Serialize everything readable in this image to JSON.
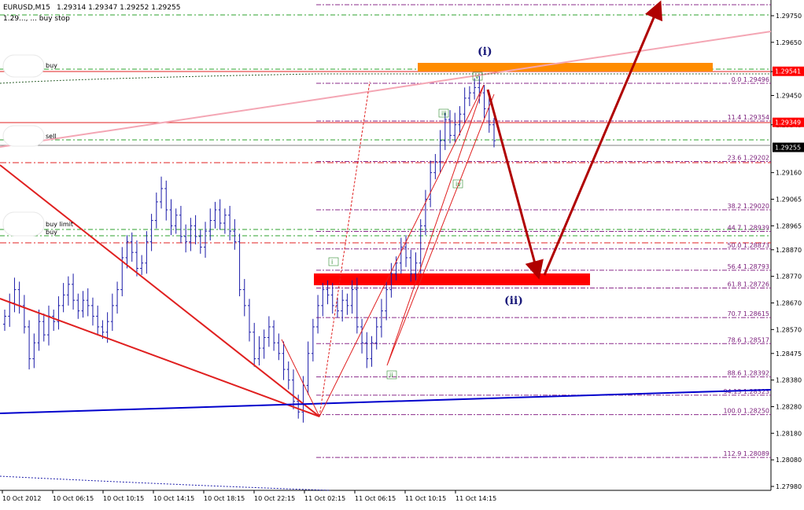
{
  "header": {
    "symbol": "EURUSD,M15",
    "quote": "1.29314 1.29347 1.29252 1.29255",
    "subtitle": "1.29..., ... buy stop"
  },
  "colors": {
    "background": "#ffffff",
    "candle": "#1a1aa8",
    "fib": "#8b2c8b",
    "trend_line": "#e02020",
    "support_line": "#0000cc",
    "arrow": "#b00000",
    "orange_zone": "#ff8c00",
    "red_zone": "#ff0000",
    "pink_line": "#f4a6b4",
    "green_dash": "#2ea02e",
    "price_tag_red": "#ff0000",
    "price_tag_black": "#000000"
  },
  "chart_data": {
    "type": "candlestick",
    "title": "EURUSD,M15",
    "y_axis": {
      "ticks": [
        1.2975,
        1.2965,
        1.2954,
        1.2945,
        1.2934,
        1.2916,
        1.2906,
        1.2896,
        1.2887,
        1.2877,
        1.2867,
        1.2857,
        1.2848,
        1.2838,
        1.2828,
        1.2818,
        1.2808,
        1.2798
      ],
      "tick_labels": [
        "1.29750",
        "1.29650",
        "1.29541",
        "1.29450",
        "1.29349",
        "1.29160",
        "1.29065",
        "1.28965",
        "1.28870",
        "1.28770",
        "1.28670",
        "1.28570",
        "1.28475",
        "1.28380",
        "1.28280",
        "1.28180",
        "1.28080",
        "1.27980"
      ],
      "range": [
        1.2796,
        1.2979
      ]
    },
    "x_axis": {
      "tick_labels": [
        "10 Oct 2012",
        "10 Oct 06:15",
        "10 Oct 10:15",
        "10 Oct 14:15",
        "10 Oct 18:15",
        "10 Oct 22:15",
        "11 Oct 02:15",
        "11 Oct 06:15",
        "11 Oct 10:15",
        "11 Oct 14:15"
      ]
    },
    "price_tags": [
      {
        "value": 1.29541,
        "label": "1.29541",
        "style": "red"
      },
      {
        "value": 1.29349,
        "label": "1.29349",
        "style": "red"
      },
      {
        "value": 1.29255,
        "label": "1.29255",
        "style": "black"
      }
    ],
    "fib_levels": [
      {
        "label": "0.0 1.29496",
        "value": 1.29496
      },
      {
        "label": "11.4 1.29354",
        "value": 1.29354
      },
      {
        "label": "23.6 1.29202",
        "value": 1.29202
      },
      {
        "label": "38.2 1.29020",
        "value": 1.2902
      },
      {
        "label": "44.7 1.28939",
        "value": 1.28939
      },
      {
        "label": "50.0 1.28873",
        "value": 1.28873
      },
      {
        "label": "56.4 1.28793",
        "value": 1.28793
      },
      {
        "label": "61.8 1.28726",
        "value": 1.28726
      },
      {
        "label": "70.7 1.28615",
        "value": 1.28615
      },
      {
        "label": "78.6 1.28517",
        "value": 1.28517
      },
      {
        "label": "88.6 1.28392",
        "value": 1.28392
      },
      {
        "label": "94.13 1.28323",
        "value": 1.28323
      },
      {
        "label": "100.0 1.28250",
        "value": 1.2825
      },
      {
        "label": "112.9 1.28089",
        "value": 1.28089
      }
    ],
    "order_labels": [
      "buy",
      "sell",
      "buy limit",
      "buy"
    ],
    "wave_labels": [
      "(i)",
      "(ii)"
    ],
    "sub_wave_labels": [
      "i",
      "ii",
      "iii",
      "iv",
      "v"
    ],
    "close_series": [
      1.2862,
      1.2867,
      1.2872,
      1.2866,
      1.2858,
      1.2846,
      1.2852,
      1.286,
      1.2855,
      1.2862,
      1.286,
      1.2866,
      1.287,
      1.2874,
      1.2868,
      1.2864,
      1.2868,
      1.2866,
      1.2862,
      1.2858,
      1.2856,
      1.286,
      1.2866,
      1.2872,
      1.2884,
      1.289,
      1.2886,
      1.288,
      1.2882,
      1.289,
      1.2898,
      1.2905,
      1.291,
      1.2902,
      1.2896,
      1.29,
      1.2892,
      1.289,
      1.2896,
      1.2892,
      1.2888,
      1.2894,
      1.2898,
      1.2902,
      1.2897,
      1.29,
      1.2894,
      1.289,
      1.2872,
      1.2866,
      1.2856,
      1.2846,
      1.285,
      1.2854,
      1.2858,
      1.2852,
      1.2848,
      1.2842,
      1.2838,
      1.283,
      1.2826,
      1.2836,
      1.2848,
      1.2858,
      1.2866,
      1.2872,
      1.287,
      1.2866,
      1.2864,
      1.2868,
      1.2866,
      1.2872,
      1.2858,
      1.2852,
      1.2846,
      1.2852,
      1.2858,
      1.2864,
      1.2872,
      1.2878,
      1.2882,
      1.2888,
      1.2884,
      1.2878,
      1.2882,
      1.2896,
      1.2906,
      1.2916,
      1.292,
      1.2928,
      1.2936,
      1.293,
      1.2934,
      1.2938,
      1.2944,
      1.2946,
      1.2948,
      1.2946,
      1.294,
      1.2934,
      1.2928
    ]
  }
}
